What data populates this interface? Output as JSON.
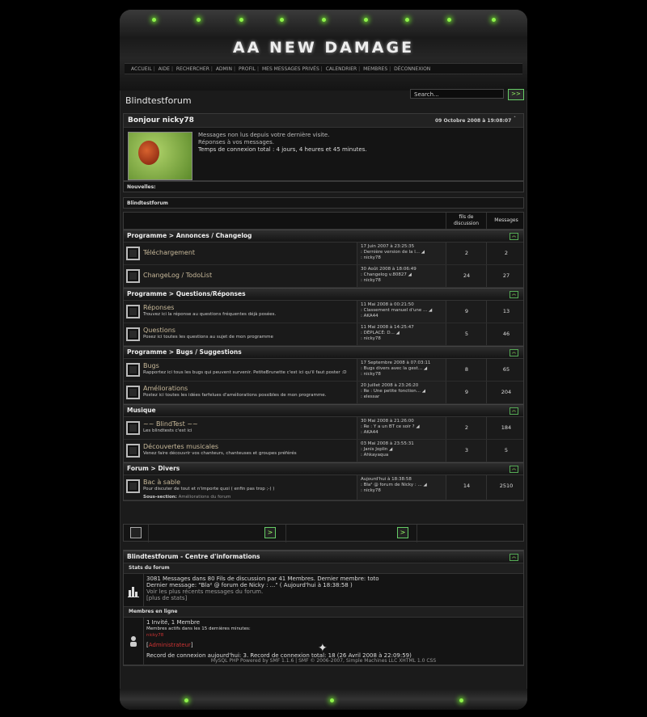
{
  "header": {
    "logo": "AA NEW DAMAGE",
    "menu": [
      "ACCUEIL",
      "AIDE",
      "RECHERCHER",
      "ADMIN",
      "PROFIL",
      "MES MESSAGES PRIVÉS",
      "CALENDRIER",
      "MEMBRES",
      "DÉCONNEXION"
    ]
  },
  "page": {
    "forum_title": "Blindtestforum",
    "search_placeholder": "Search...",
    "search_button": ">>"
  },
  "welcome": {
    "greeting": "Bonjour nicky78",
    "date": "09 Octobre 2008 à 19:08:07",
    "toggle": "ˆ",
    "line1": "Messages non lus depuis votre dernière visite.",
    "line2": "Réponses à vos messages.",
    "line3": "Temps de connexion total : 4 jours, 4 heures et 45 minutes.",
    "news_label": "Nouvelles:"
  },
  "breadcrumb": "Blindtestforum",
  "table": {
    "col_topics": "fils de discussion",
    "col_messages": "Messages",
    "categories": [
      {
        "title": "Programme > Annonces / Changelog",
        "boards": [
          {
            "name": "Téléchargement",
            "desc": "",
            "last1": "17 Juin 2007 à 23:25:35",
            "last2": ": Dernière version de la l... ◢",
            "last3": ": nicky78",
            "topics": "2",
            "posts": "2"
          },
          {
            "name": "ChangeLog / TodoList",
            "desc": "",
            "last1": "30 Août 2008 à 18:06:49",
            "last2": ": Changelog v.80827 ◢",
            "last3": ": nicky78",
            "topics": "24",
            "posts": "27"
          }
        ]
      },
      {
        "title": "Programme > Questions/Réponses",
        "boards": [
          {
            "name": "Réponses",
            "desc": "Trouvez ici la réponse au questions fréquentes déjà posées.",
            "last1": "11 Mai 2008 à 00:21:50",
            "last2": ": Classement manuel d'une ... ◢",
            "last3": ": AKA44",
            "topics": "9",
            "posts": "13"
          },
          {
            "name": "Questions",
            "desc": "Posez ici toutes les questions au sujet de mon programme",
            "last1": "11 Mai 2008 à 14:25:47",
            "last2": ": DÉPLACÉ: D... ◢",
            "last3": ": nicky78",
            "topics": "5",
            "posts": "46"
          }
        ]
      },
      {
        "title": "Programme > Bugs / Suggestions",
        "boards": [
          {
            "name": "Bugs",
            "desc": "Rapportez ici tous les bugs qui peuvent survenir. PetiteBrunette c'est ici qu'il faut poster :D",
            "last1": "17 Septembre 2008 à 07:03:11",
            "last2": ": Bugs divers avec la gest... ◢",
            "last3": ": nicky78",
            "topics": "8",
            "posts": "65"
          },
          {
            "name": "Améliorations",
            "desc": "Postez ici toutes les idées farfelues d'améliorations possibles de mon programme.",
            "last1": "20 Juillet 2008 à 23:26:20",
            "last2": ": Re : Une petite fonction... ◢",
            "last3": ": elessar",
            "topics": "9",
            "posts": "204"
          }
        ]
      },
      {
        "title": "Musique",
        "boards": [
          {
            "name": "~~ BlindTest ~~",
            "desc": "Les blindtests c'est ici",
            "last1": "30 Mai 2008 à 21:26:00",
            "last2": ": Re : Y a un BT ce soir ? ◢",
            "last3": ": AKA44",
            "topics": "2",
            "posts": "184"
          },
          {
            "name": "Découvertes musicales",
            "desc": "Venez faire découvrir vos chanteurs, chanteuses et groupes préférés",
            "last1": "03 Mai 2008 à 23:55:31",
            "last2": ": Janis Joplin ◢",
            "last3": ": Ahkayaqua",
            "topics": "3",
            "posts": "5"
          }
        ]
      },
      {
        "title": "Forum > Divers",
        "boards": [
          {
            "name": "Bac à sable",
            "desc": "Pour discuter de tout et n'importe quoi ( enfin pas trop ;-) )",
            "sub_label": "Sous-section:",
            "sub_value": "Améliorations du forum",
            "last1": "Aujourd'hui à 18:38:58",
            "last2": ": Bla² @ forum de Nicky : ... ◢",
            "last3": ": nicky78",
            "topics": "14",
            "posts": "2510"
          }
        ]
      }
    ]
  },
  "pager": {
    "arrow": ">"
  },
  "info": {
    "title": "Blindtestforum - Centre d'informations",
    "stats_label": "Stats du forum",
    "stats_line1": "3081 Messages dans 80 Fils de discussion par 41 Membres. Dernier membre: toto",
    "stats_line2": "Dernier message: \"Bla² @ forum de Nicky : ...\" ( Aujourd'hui à 18:38:58 )",
    "stats_line3": "Voir les plus récents messages du forum.",
    "stats_line4": "[plus de stats]",
    "online_label": "Membres en ligne",
    "online_line1": "1 Invité, 1 Membre",
    "online_line2": "Membres actifs dans les 15 dernières minutes:",
    "online_user": "nicky78",
    "online_group": "Administrateur",
    "record": "Record de connexion aujourd'hui: 3. Record de connexion total: 18 (26 Avril 2008 à 22:09:59)"
  },
  "footer": {
    "text": "MySQL PHP     Powered by SMF 1.1.6 | SMF © 2006-2007, Simple Machines LLC     XHTML 1.0 CSS"
  },
  "colors": {
    "accent": "#8ef24a",
    "link": "#c8b99a",
    "admin": "#cc3333"
  }
}
